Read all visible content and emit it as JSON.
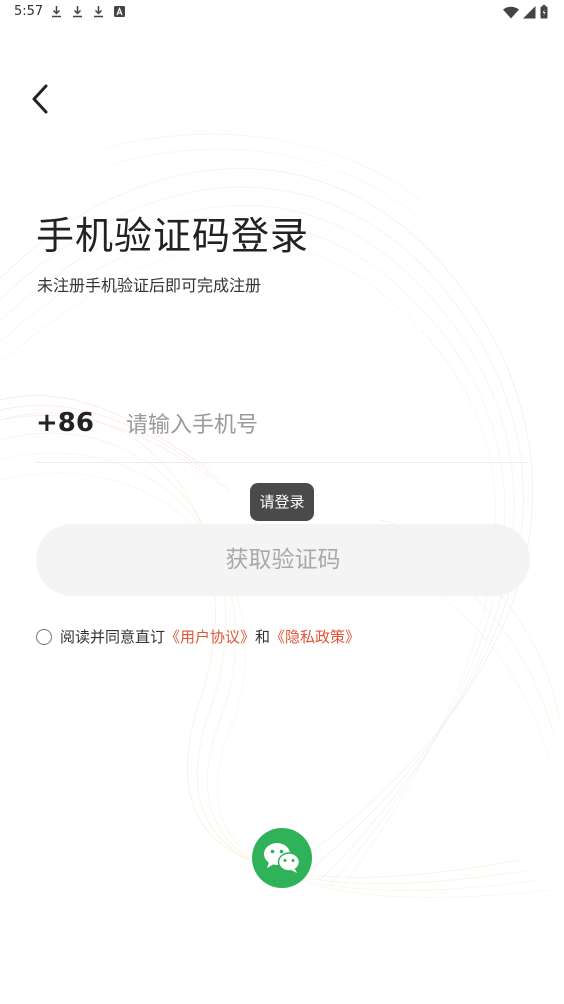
{
  "status_bar": {
    "time": "5:57",
    "left_icons": [
      "download-icon",
      "download-icon",
      "download-icon",
      "font-a-icon"
    ],
    "right_icons": [
      "wifi-icon",
      "signal-icon",
      "battery-icon"
    ]
  },
  "header": {
    "back_icon": "chevron-left-icon"
  },
  "login": {
    "title": "手机验证码登录",
    "subtitle": "未注册手机验证后即可完成注册",
    "country_code": "+86",
    "phone_placeholder": "请输入手机号",
    "phone_value": "",
    "tooltip": "请登录",
    "get_code_button": "获取验证码"
  },
  "agreement": {
    "checked": false,
    "prefix": "阅读并同意直订",
    "user_agreement": "《用户协议》",
    "and": "和",
    "privacy_policy": "《隐私政策》"
  },
  "third_party": {
    "wechat_icon": "wechat-icon"
  },
  "colors": {
    "link": "#e0553a",
    "wechat": "#2fb25a",
    "button_bg": "#f4f4f4",
    "button_text": "#a9a9a9",
    "tooltip_bg": "#4a4a4a"
  }
}
